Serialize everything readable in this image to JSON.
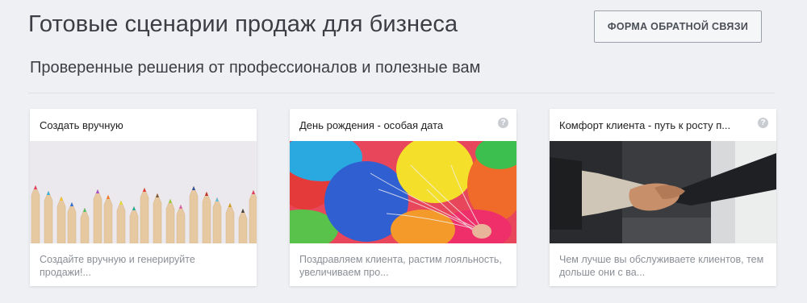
{
  "header": {
    "title": "Готовые сценарии продаж для бизнеса",
    "feedback_button": "ФОРМА ОБРАТНОЙ СВЯЗИ"
  },
  "subtitle": "Проверенные решения от профессионалов и полезные вам",
  "cards": [
    {
      "title": "Создать вручную",
      "description": "Создайте вручную и генерируйте продажи!...",
      "image": "colored-pencils",
      "has_help": false
    },
    {
      "title": "День рождения - особая дата",
      "description": "Поздравляем клиента, растим лояльность, увеличиваем про...",
      "image": "balloons",
      "has_help": true
    },
    {
      "title": "Комфорт клиента - путь к росту п...",
      "description": "Чем лучше вы обслуживаете клиентов, тем дольше они с ва...",
      "image": "handshake",
      "has_help": true
    }
  ],
  "help_icon_glyph": "?"
}
